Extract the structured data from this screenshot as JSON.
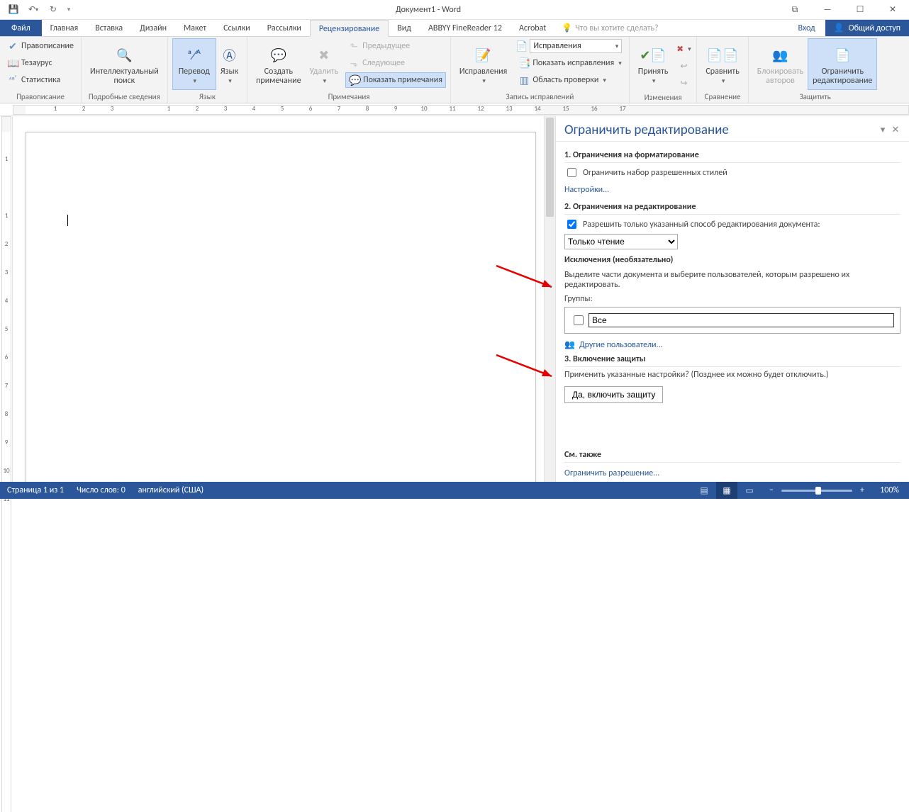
{
  "title": "Документ1 - Word",
  "qat": {
    "items": [
      "save",
      "undo",
      "redo"
    ]
  },
  "win": {
    "ribbon_opts": "⧉",
    "min": "—",
    "max": "☐",
    "close": "✕"
  },
  "tabs": {
    "file": "Файл",
    "items": [
      "Главная",
      "Вставка",
      "Дизайн",
      "Макет",
      "Ссылки",
      "Рассылки",
      "Рецензирование",
      "Вид",
      "ABBYY FineReader 12",
      "Acrobat"
    ],
    "active_index": 6,
    "tellme_placeholder": "Что вы хотите сделать?",
    "signin": "Вход",
    "share": "Общий доступ"
  },
  "ribbon": {
    "proofing": {
      "label": "Правописание",
      "spelling": "Правописание",
      "thesaurus": "Тезаурус",
      "stats": "Статистика"
    },
    "insights": {
      "label": "Подробные сведения",
      "smart": "Интеллектуальный\nпоиск"
    },
    "language": {
      "label": "Язык",
      "translate": "Перевод",
      "lang": "Язык"
    },
    "comments": {
      "label": "Примечания",
      "new": "Создать\nпримечание",
      "delete": "Удалить",
      "prev": "Предыдущее",
      "next": "Следующее",
      "show": "Показать примечания"
    },
    "tracking": {
      "label": "Запись исправлений",
      "track": "Исправления",
      "display_combo": "Исправления",
      "show_markup": "Показать исправления",
      "pane": "Область проверки"
    },
    "changes": {
      "label": "Изменения",
      "accept": "Принять"
    },
    "compare": {
      "label": "Сравнение",
      "compare": "Сравнить"
    },
    "protect": {
      "label": "Защитить",
      "block": "Блокировать\nавторов",
      "restrict": "Ограничить\nредактирование"
    }
  },
  "ruler": {
    "h": [
      "",
      "1",
      "2",
      "3",
      "",
      "1",
      "2",
      "3",
      "4",
      "5",
      "6",
      "7",
      "8",
      "9",
      "10",
      "11",
      "12",
      "13",
      "14",
      "15",
      "16",
      "17"
    ],
    "v": [
      "",
      "1",
      "",
      "1",
      "2",
      "3",
      "4",
      "5",
      "6",
      "7",
      "8",
      "9",
      "10",
      "11"
    ]
  },
  "pane": {
    "title": "Ограничить редактирование",
    "sec1": "1. Ограничения на форматирование",
    "sec1_chk": "Ограничить набор разрешенных стилей",
    "sec1_link": "Настройки...",
    "sec2": "2. Ограничения на редактирование",
    "sec2_chk": "Разрешить только указанный способ редактирования документа:",
    "sec2_combo": "Только чтение",
    "exc_h": "Исключения (необязательно)",
    "exc_txt": "Выделите части документа и выберите пользователей, которым разрешено их\nредактировать.",
    "groups": "Группы:",
    "all": "Все",
    "more": "Другие пользователи...",
    "sec3": "3. Включение защиты",
    "sec3_txt": "Применить указанные настройки? (Позднее их можно будет отключить.)",
    "sec3_btn": "Да, включить защиту",
    "see_also": "См. также",
    "see_link": "Ограничить разрешение..."
  },
  "status": {
    "page": "Страница 1 из 1",
    "words": "Число слов: 0",
    "lang": "английский (США)",
    "zoom": "100%"
  }
}
